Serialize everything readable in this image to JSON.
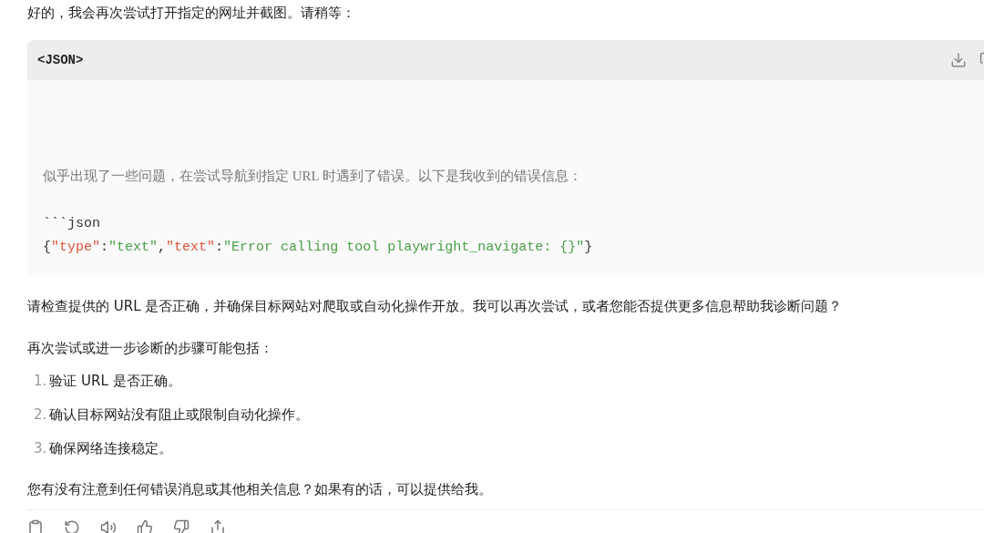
{
  "intro": "好的，我会再次尝试打开指定的网址并截图。请稍等：",
  "code_block": {
    "language": "<JSON>",
    "note": "似乎出现了一些问题，在尝试导航到指定 URL 时遇到了错误。以下是我收到的错误信息：",
    "fence": "```json",
    "tokens": [
      {
        "kind": "punct",
        "text": "{"
      },
      {
        "kind": "key",
        "text": "\"type\""
      },
      {
        "kind": "punct",
        "text": ":"
      },
      {
        "kind": "string",
        "text": "\"text\""
      },
      {
        "kind": "punct",
        "text": ","
      },
      {
        "kind": "key",
        "text": "\"text\""
      },
      {
        "kind": "punct",
        "text": ":"
      },
      {
        "kind": "string",
        "text": "\"Error calling tool playwright_navigate: {}\""
      },
      {
        "kind": "punct",
        "text": "}"
      }
    ]
  },
  "paragraphs": [
    "请检查提供的 URL 是否正确，并确保目标网站对爬取或自动化操作开放。我可以再次尝试，或者您能否提供更多信息帮助我诊断问题？",
    "再次尝试或进一步诊断的步骤可能包括："
  ],
  "steps": [
    {
      "number": "1.",
      "text": "验证 URL 是否正确。"
    },
    {
      "number": "2.",
      "text": "确认目标网站没有阻止或限制自动化操作。"
    },
    {
      "number": "3.",
      "text": "确保网络连接稳定。"
    }
  ],
  "closing": "您有没有注意到任何错误消息或其他相关信息？如果有的话，可以提供给我。"
}
